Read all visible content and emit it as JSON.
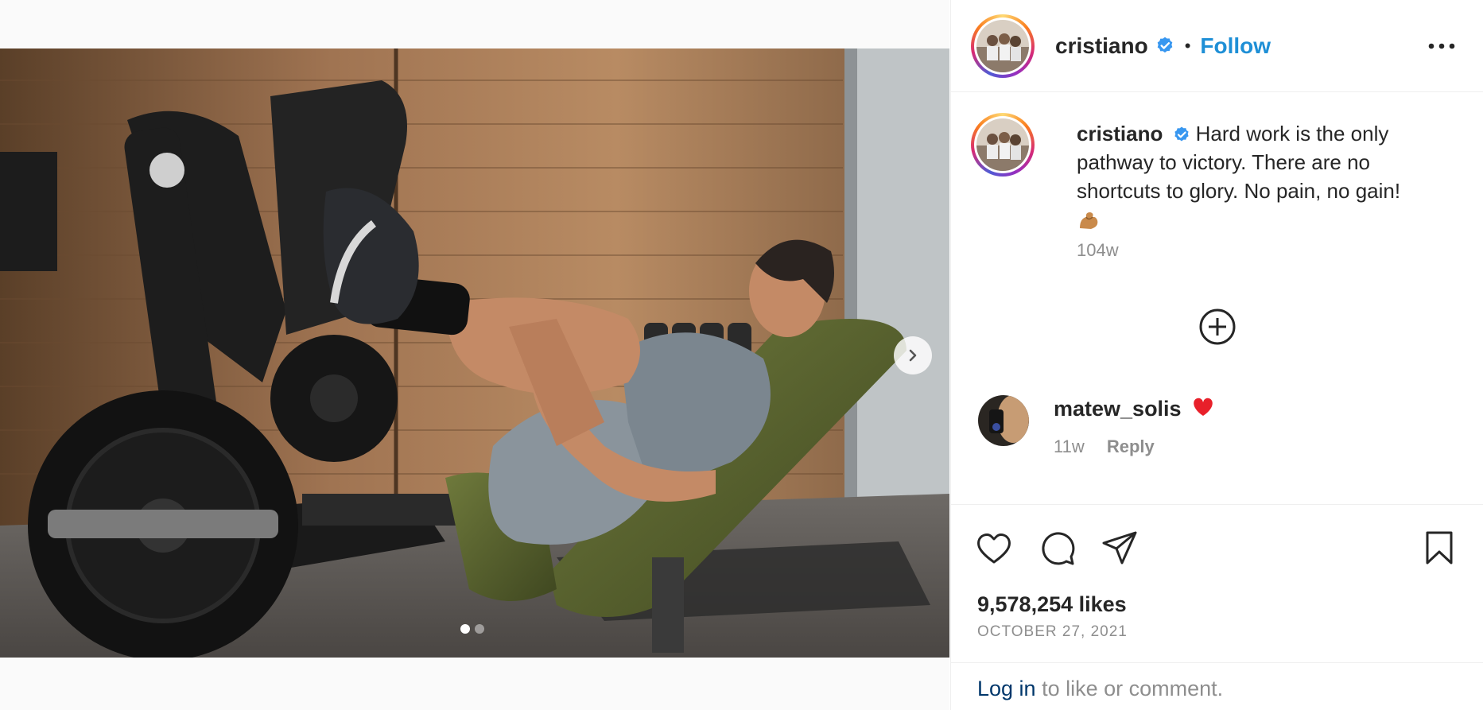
{
  "post": {
    "carousel": {
      "slide_count": 2,
      "active_index": 0
    }
  },
  "header": {
    "username": "cristiano",
    "separator": "•",
    "follow_label": "Follow",
    "verified_icon": "verified-badge-icon",
    "more_icon": "more-options-icon"
  },
  "caption": {
    "username": "cristiano",
    "text": "Hard work is the only pathway to victory. There are no shortcuts to glory. No pain, no gain!",
    "emoji": "💪",
    "time_ago": "104w"
  },
  "comments": {
    "load_more_icon": "plus-circle-icon",
    "items": [
      {
        "username": "matew_solis",
        "emoji": "❤️",
        "time_ago": "11w",
        "reply_label": "Reply"
      }
    ]
  },
  "actions": {
    "like_icon": "heart-icon",
    "comment_icon": "comment-icon",
    "share_icon": "share-icon",
    "save_icon": "bookmark-icon"
  },
  "stats": {
    "likes": "9,578,254 likes",
    "date": "OCTOBER 27, 2021"
  },
  "footer": {
    "login_label": "Log in",
    "login_suffix": " to like or comment."
  },
  "colors": {
    "link_blue": "#1e8fd6",
    "muted": "#8e8e8e",
    "text": "#262626"
  }
}
